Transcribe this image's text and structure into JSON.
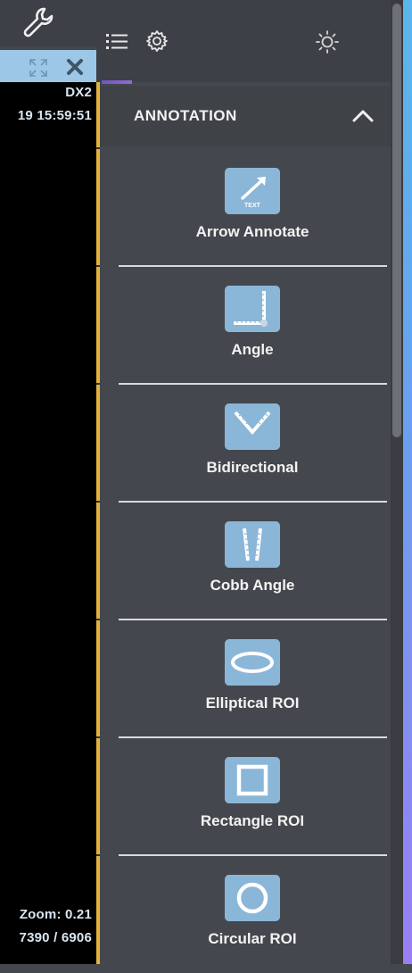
{
  "viewer": {
    "modality": "DX2",
    "datetime": "19 15:59:51",
    "zoom": "Zoom: 0.21",
    "dimensions": "7390 / 6906"
  },
  "panel": {
    "section_title": "ANNOTATION",
    "tools": [
      {
        "label": "Arrow Annotate",
        "icon": "arrow-annotate-icon",
        "icon_text": "TEXT"
      },
      {
        "label": "Angle",
        "icon": "angle-icon"
      },
      {
        "label": "Bidirectional",
        "icon": "bidirectional-icon"
      },
      {
        "label": "Cobb Angle",
        "icon": "cobb-angle-icon"
      },
      {
        "label": "Elliptical ROI",
        "icon": "elliptical-roi-icon"
      },
      {
        "label": "Rectangle ROI",
        "icon": "rectangle-roi-icon"
      },
      {
        "label": "Circular ROI",
        "icon": "circular-roi-icon"
      }
    ]
  },
  "colors": {
    "accent_yellow": "#e3b23c",
    "tool_icon_bg": "#8ab6d8",
    "panel_bg": "#44474d",
    "viewport_header": "#9cc7e6"
  }
}
